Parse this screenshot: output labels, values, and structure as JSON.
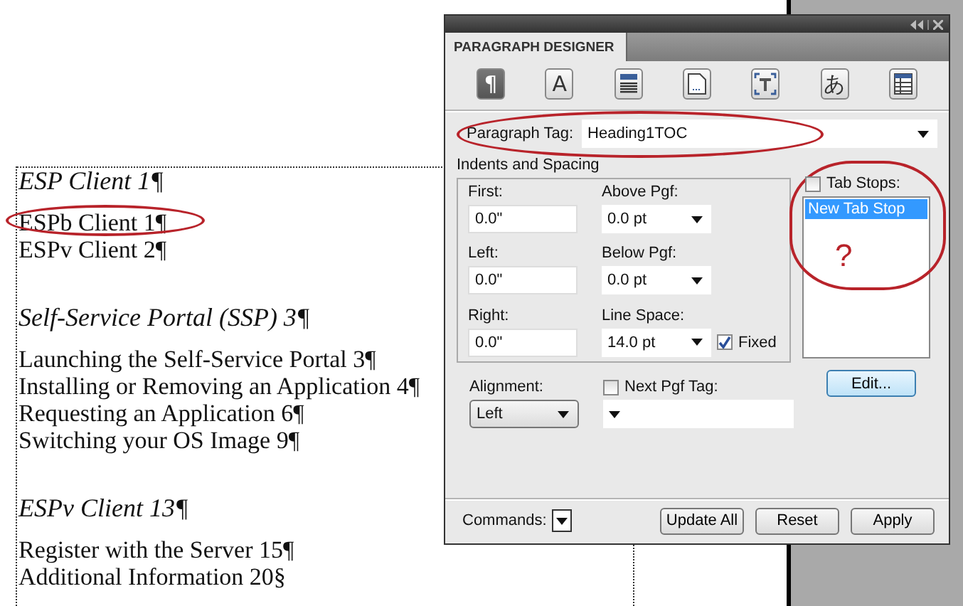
{
  "document": {
    "lines": [
      {
        "kind": "heading",
        "text": "ESP Client 1¶",
        "circled": false
      },
      {
        "kind": "entry",
        "text": "ESPb Client 1¶",
        "circled": true
      },
      {
        "kind": "entry",
        "text": "ESPv Client 2¶",
        "circled": false
      },
      {
        "kind": "heading",
        "text": "Self-Service Portal (SSP) 3¶",
        "circled": false
      },
      {
        "kind": "entry",
        "text": "Launching the Self-Service Portal 3¶",
        "circled": false
      },
      {
        "kind": "entry",
        "text": "Installing or Removing an Application 4¶",
        "circled": false
      },
      {
        "kind": "entry",
        "text": "Requesting an Application 6¶",
        "circled": false
      },
      {
        "kind": "entry",
        "text": "Switching your OS Image 9¶",
        "circled": false
      },
      {
        "kind": "heading",
        "text": "ESPv Client 13¶",
        "circled": false
      },
      {
        "kind": "entry",
        "text": "Register with the Server 15¶",
        "circled": false
      },
      {
        "kind": "entry",
        "text": "Additional Information 20§",
        "circled": false
      }
    ]
  },
  "panel": {
    "tabs": [
      {
        "label": "PARAGRAPH DESIGNER",
        "selected": true
      }
    ],
    "toolbar": [
      {
        "kind": "glyph",
        "glyph": "¶",
        "selected": true
      },
      {
        "kind": "glyph",
        "glyph": "A",
        "selected": false
      },
      {
        "kind": "lines",
        "selected": false
      },
      {
        "kind": "page",
        "selected": false
      },
      {
        "kind": "frame",
        "selected": false
      },
      {
        "kind": "glyph",
        "glyph": "あ",
        "selected": false
      },
      {
        "kind": "table",
        "selected": false
      }
    ],
    "paragraph_tag": {
      "label": "Paragraph Tag:",
      "value": "Heading1TOC"
    },
    "group_title": "Indents and Spacing",
    "indents": [
      {
        "label": "First:",
        "value": "0.0\""
      },
      {
        "label": "Left:",
        "value": "0.0\""
      },
      {
        "label": "Right:",
        "value": "0.0\""
      }
    ],
    "spacing": [
      {
        "label": "Above Pgf:",
        "value": "0.0 pt"
      },
      {
        "label": "Below Pgf:",
        "value": "0.0 pt"
      },
      {
        "label": "Line Space:",
        "value": "14.0 pt"
      }
    ],
    "fixed": {
      "label": "Fixed",
      "checked": true
    },
    "tab_stops": {
      "label": "Tab Stops:",
      "checked": false,
      "items": [
        {
          "text": "New Tab Stop",
          "selected": true
        }
      ],
      "annotation": "?"
    },
    "edit_button": "Edit...",
    "alignment": {
      "label": "Alignment:",
      "value": "Left"
    },
    "next_pgf_tag": {
      "label": "Next Pgf Tag:",
      "checked": false
    },
    "commands_label": "Commands:",
    "buttons": [
      "Update All",
      "Reset",
      "Apply"
    ]
  }
}
